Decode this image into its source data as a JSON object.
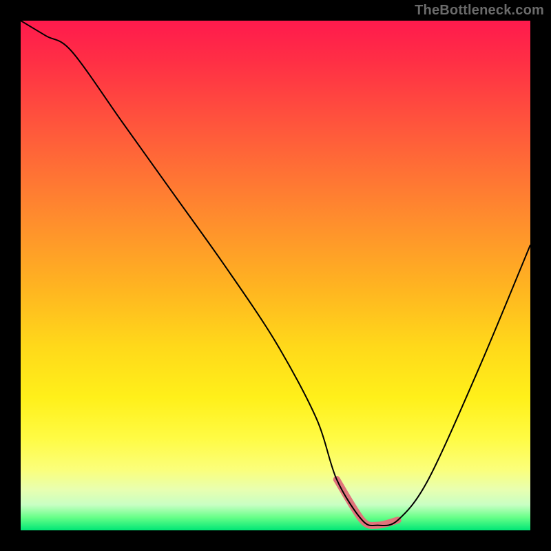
{
  "watermark": "TheBottleneck.com",
  "colors": {
    "grad_top": "#ff1a4d",
    "grad_mid": "#ffd91a",
    "grad_bottom": "#00e676",
    "line": "#000000",
    "trough": "#e0747b",
    "page_bg": "#000000"
  },
  "chart_data": {
    "type": "line",
    "title": "",
    "xlabel": "",
    "ylabel": "",
    "xlim": [
      0,
      100
    ],
    "ylim": [
      0,
      100
    ],
    "grid": false,
    "legend": false,
    "series": [
      {
        "name": "curve",
        "x": [
          0,
          5,
          10,
          20,
          30,
          40,
          50,
          58,
          62,
          67,
          70,
          74,
          80,
          90,
          100
        ],
        "values": [
          100,
          97,
          94,
          80,
          66,
          52,
          37,
          22,
          10,
          2,
          1,
          2,
          10,
          32,
          56
        ]
      }
    ],
    "annotations": [
      {
        "name": "trough-highlight",
        "x_range": [
          62,
          74
        ],
        "note": "flat minimum region, thick muted-red stroke"
      }
    ]
  }
}
